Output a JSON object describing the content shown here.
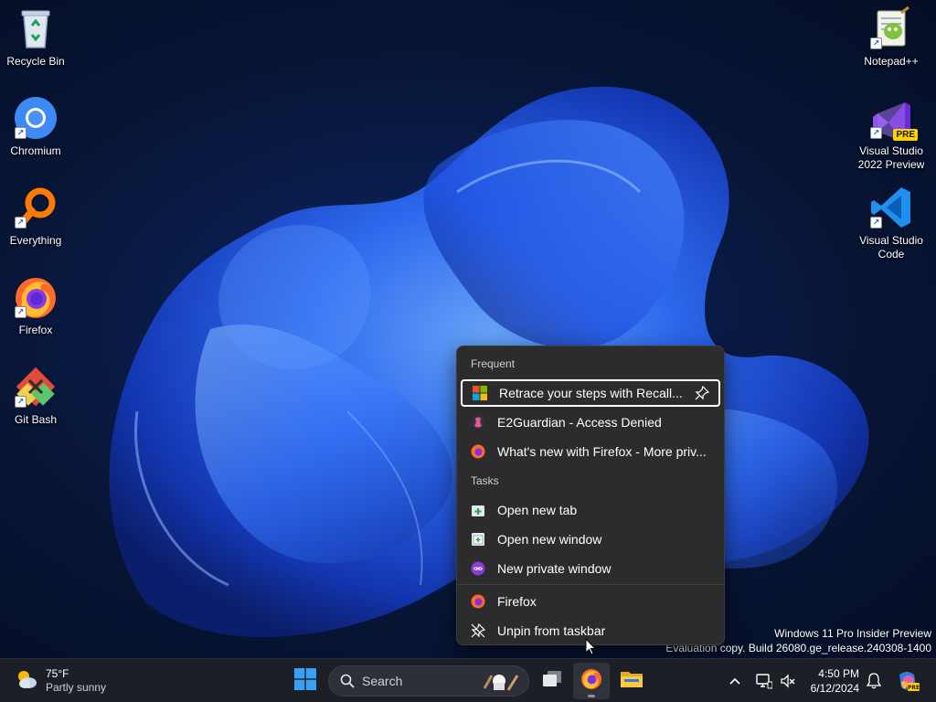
{
  "desktop": {
    "left_icons": [
      {
        "label": "Recycle Bin",
        "icon": "recycle-bin-icon"
      },
      {
        "label": "Chromium",
        "icon": "chromium-icon"
      },
      {
        "label": "Everything",
        "icon": "everything-search-icon"
      },
      {
        "label": "Firefox",
        "icon": "firefox-icon"
      },
      {
        "label": "Git Bash",
        "icon": "git-bash-icon"
      }
    ],
    "right_icons": [
      {
        "label": "Notepad++",
        "icon": "notepad-plus-plus-icon"
      },
      {
        "label": "Visual Studio 2022 Preview",
        "icon": "visual-studio-preview-icon",
        "badge": "PRE"
      },
      {
        "label": "Visual Studio Code",
        "icon": "vscode-icon"
      }
    ]
  },
  "jumplist": {
    "frequent_header": "Frequent",
    "frequent": [
      {
        "label": "Retrace your steps with Recall...",
        "icon": "microsoft-logo-icon",
        "highlighted": true
      },
      {
        "label": "E2Guardian - Access Denied",
        "icon": "e2guardian-icon"
      },
      {
        "label": "What's new with Firefox - More priv...",
        "icon": "firefox-icon"
      }
    ],
    "tasks_header": "Tasks",
    "tasks": [
      {
        "label": "Open new tab",
        "icon": "new-tab-icon"
      },
      {
        "label": "Open new window",
        "icon": "new-window-icon"
      },
      {
        "label": "New private window",
        "icon": "private-window-icon"
      }
    ],
    "app_items": [
      {
        "label": "Firefox",
        "icon": "firefox-icon"
      },
      {
        "label": "Unpin from taskbar",
        "icon": "unpin-icon"
      }
    ]
  },
  "watermark": {
    "line1": "Windows 11 Pro Insider Preview",
    "line2": "Evaluation copy. Build 26080.ge_release.240308-1400"
  },
  "taskbar": {
    "weather": {
      "temp": "75°F",
      "condition": "Partly sunny"
    },
    "search_placeholder": "Search",
    "apps": [
      {
        "name": "start",
        "icon": "windows-start-icon"
      },
      {
        "name": "task-view",
        "icon": "task-view-icon"
      },
      {
        "name": "firefox",
        "icon": "firefox-icon",
        "active": true
      },
      {
        "name": "file-explorer",
        "icon": "folder-icon"
      }
    ],
    "clock": {
      "time": "4:50 PM",
      "date": "6/12/2024"
    }
  },
  "colors": {
    "menu_bg": "#2c2c2c",
    "taskbar_bg": "#1c1f26",
    "accent_blue": "#1e5cff"
  }
}
